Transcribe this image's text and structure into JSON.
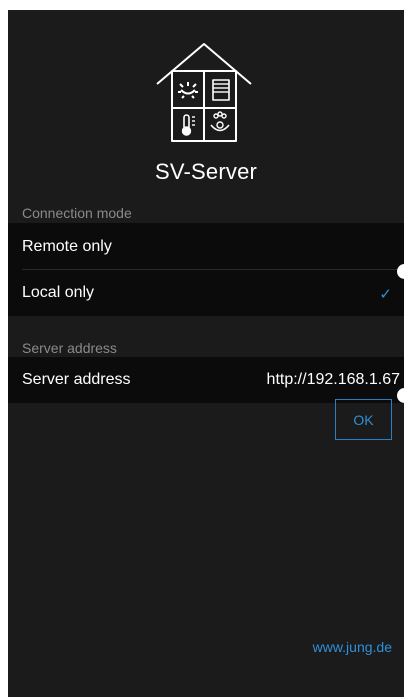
{
  "app": {
    "title": "SV-Server",
    "logo_icon": "smart-home-house-icon"
  },
  "connection_mode": {
    "header": "Connection mode",
    "options": [
      {
        "label": "Remote only",
        "selected": false
      },
      {
        "label": "Local only",
        "selected": true
      }
    ],
    "check_glyph": "✓"
  },
  "server": {
    "header": "Server address",
    "label": "Server address",
    "value": "http://192.168.1.67"
  },
  "ok_button": {
    "label": "OK"
  },
  "footer": {
    "link": "www.jung.de"
  },
  "colors": {
    "background": "#1b1b1c",
    "row_background": "#0b0b0b",
    "accent": "#2f8fd8",
    "section_header": "#8a8a8e"
  }
}
